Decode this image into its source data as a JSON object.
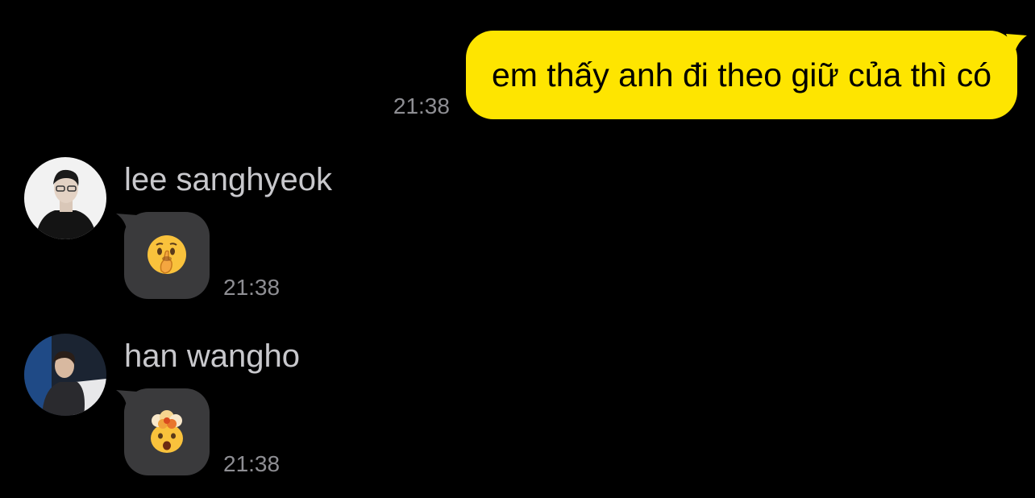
{
  "messages": {
    "outgoing": {
      "text": "em thấy anh đi theo giữ của thì có",
      "time": "21:38"
    },
    "incoming": [
      {
        "sender": "lee sanghyeok",
        "emoji_icon": "shushing-face-icon",
        "time": "21:38"
      },
      {
        "sender": "han wangho",
        "emoji_icon": "exploding-head-icon",
        "time": "21:38"
      }
    ]
  },
  "colors": {
    "background": "#000000",
    "outgoing_bubble": "#fee500",
    "incoming_bubble": "#3a3a3c",
    "timestamp": "#8e8e93",
    "sender_name": "#c8c8cc"
  }
}
